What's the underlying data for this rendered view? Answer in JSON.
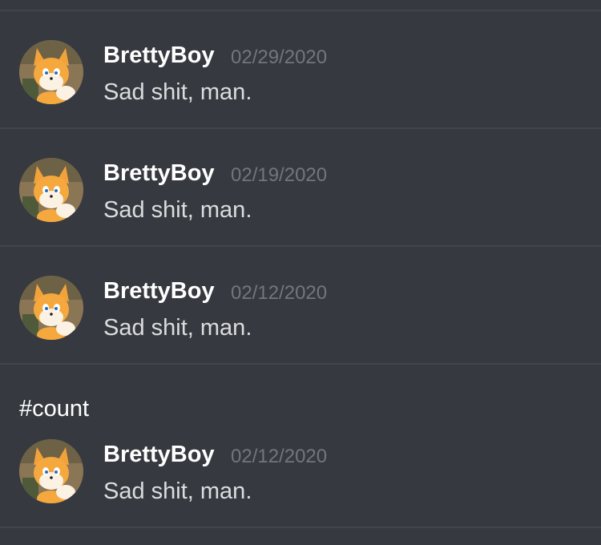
{
  "messages": [
    {
      "username": "BrettyBoy",
      "timestamp": "02/29/2020",
      "content": "Sad shit, man.",
      "avatar_icon": "tails-fox-avatar"
    },
    {
      "username": "BrettyBoy",
      "timestamp": "02/19/2020",
      "content": "Sad shit, man.",
      "avatar_icon": "tails-fox-avatar"
    },
    {
      "username": "BrettyBoy",
      "timestamp": "02/12/2020",
      "content": "Sad shit, man.",
      "avatar_icon": "tails-fox-avatar"
    }
  ],
  "standalone_text": "#count",
  "last_message": {
    "username": "BrettyBoy",
    "timestamp": "02/12/2020",
    "content": "Sad shit, man.",
    "avatar_icon": "tails-fox-avatar"
  },
  "colors": {
    "background": "#36393f",
    "divider": "#42454b",
    "username": "#ffffff",
    "timestamp": "#72767d",
    "message_text": "#dcddde"
  }
}
